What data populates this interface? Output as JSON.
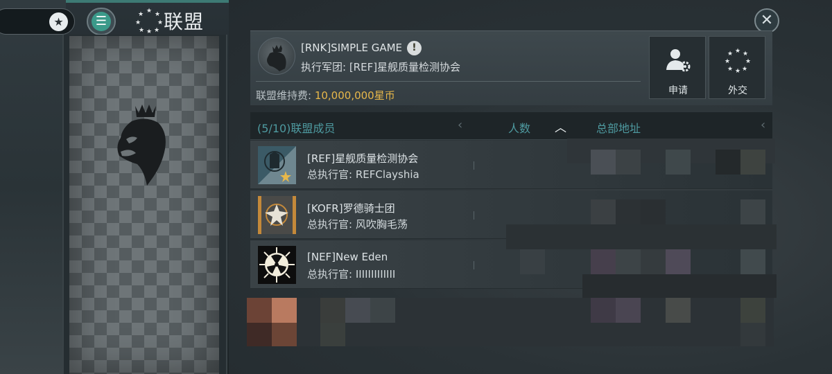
{
  "page": {
    "title": "联盟"
  },
  "nav": {
    "menu_icon": "menu-icon",
    "star_icon": "star-badge-icon"
  },
  "alliance": {
    "name": "[RNK]SIMPLE GAME",
    "executive_corps": "执行军团: [REF]星舰质量检测协会",
    "fee_label": "联盟维持费: ",
    "fee_value": "10,000,000星币"
  },
  "actions": [
    {
      "label": "申请",
      "icon": "user-gear-icon"
    },
    {
      "label": "外交",
      "icon": "stars-ring-icon"
    }
  ],
  "member_list": {
    "header": {
      "members": "(5/10)联盟成员",
      "count": "人数",
      "hq": "总部地址"
    },
    "rows": [
      {
        "name": "[REF]星舰质量检测协会",
        "leader": "总执行官: REFClayshia"
      },
      {
        "name": "[KOFR]罗德骑士团",
        "leader": "总执行官: 风吹胸毛荡"
      },
      {
        "name": "[NEF]New Eden",
        "leader": "总执行官: IIIIIIIIIIIII"
      }
    ]
  },
  "colors": {
    "accent": "#4e9aa0",
    "gold": "#e8b84a",
    "menu": "#3b9a8a"
  }
}
